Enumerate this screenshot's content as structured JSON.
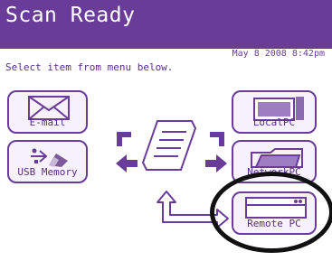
{
  "header": {
    "title": "Scan Ready",
    "date": "May  8 2008",
    "time": "8:42pm"
  },
  "menu": {
    "instruction": "Select item from menu below.",
    "email_label": "E-mail",
    "usb_label": "USB Memory",
    "localpc_label": "LocalPC",
    "network_label": "NetworkPC",
    "remote_label": "Remote PC"
  },
  "colors": {
    "primary": "#6a3c9a",
    "panel": "#f6f1fb",
    "text": "#5a2d86"
  },
  "icons": {
    "email": "envelope-icon",
    "usb": "usb-icon",
    "localpc": "monitor-icon",
    "network": "folder-icon",
    "remote": "computer-icon",
    "document": "document-icon"
  }
}
